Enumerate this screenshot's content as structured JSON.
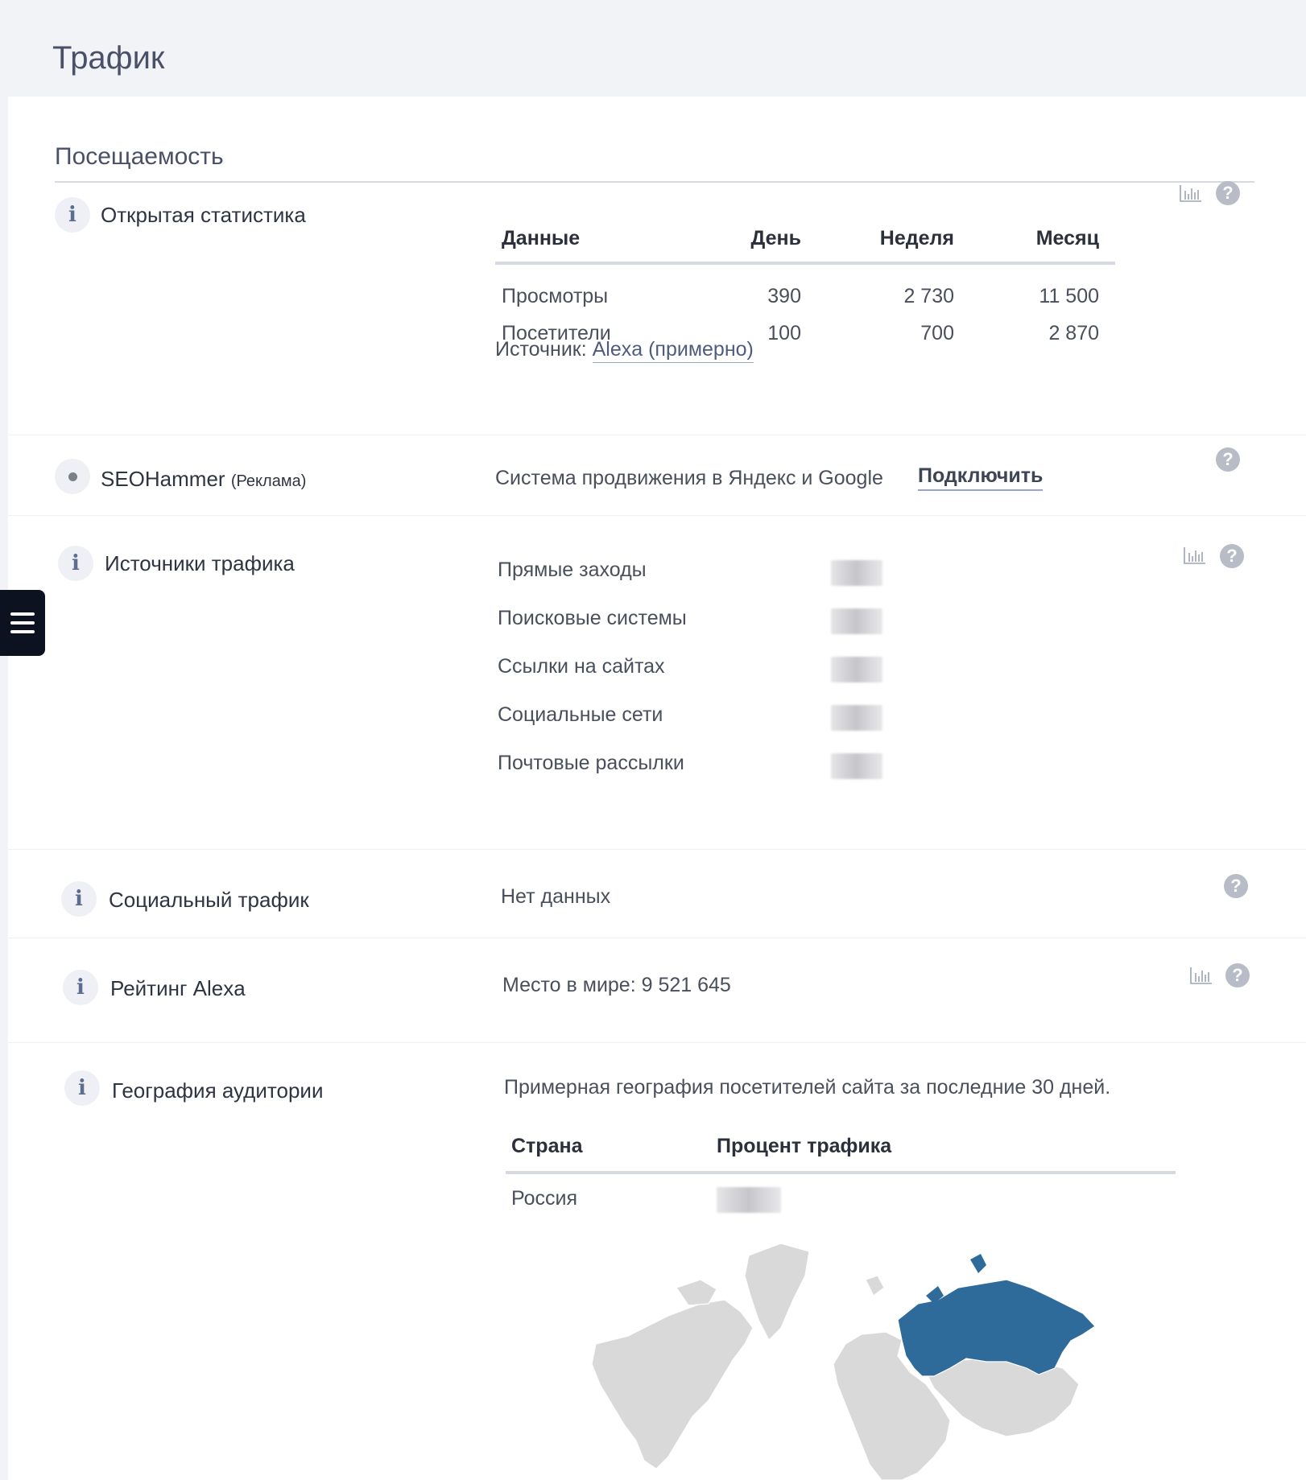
{
  "page": {
    "title": "Трафик"
  },
  "card": {
    "title": "Посещаемость"
  },
  "open_stats": {
    "label": "Открытая статистика",
    "headers": [
      "Данные",
      "День",
      "Неделя",
      "Месяц"
    ],
    "rows": [
      {
        "name": "Просмотры",
        "day": "390",
        "week": "2 730",
        "month": "11 500"
      },
      {
        "name": "Посетители",
        "day": "100",
        "week": "700",
        "month": "2 870"
      }
    ],
    "source_prefix": "Источник:",
    "source_link": "Alexa (примерно)"
  },
  "seohammer": {
    "label": "SEOHammer",
    "ad_label": "(Реклама)",
    "description": "Система продвижения в Яндекс и Google",
    "connect": "Подключить"
  },
  "traffic_sources": {
    "label": "Источники трафика",
    "items": [
      "Прямые заходы",
      "Поисковые системы",
      "Ссылки на сайтах",
      "Социальные сети",
      "Почтовые рассылки"
    ]
  },
  "social_traffic": {
    "label": "Социальный трафик",
    "value": "Нет данных"
  },
  "alexa_rank": {
    "label": "Рейтинг Alexa",
    "value": "Место в мире: 9 521 645"
  },
  "geo": {
    "label": "География аудитории",
    "description": "Примерная география посетителей сайта за последние 30 дней.",
    "headers": [
      "Страна",
      "Процент трафика"
    ],
    "rows": [
      {
        "country": "Россия"
      }
    ]
  },
  "icons": {
    "info": "i",
    "help": "?"
  },
  "colors": {
    "map_highlight": "#2f6b9a",
    "map_land": "#d9d9d9"
  }
}
